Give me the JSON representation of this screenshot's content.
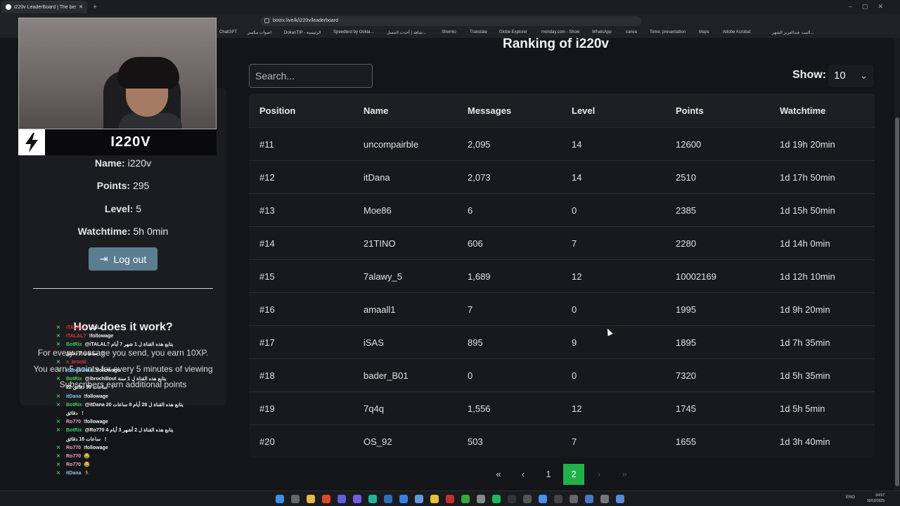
{
  "browser": {
    "tab_title": "i220v LeaderBoard | The best Ch",
    "url": "botrix.live/k/i220v/leaderboard",
    "bookmarks": [
      "ChatGPT",
      "اصوات مكسر",
      "DokanTIP - الرئيسية",
      "Speedtest by Ookla...",
      "شاهد | أحدث المسل...",
      "Stremio",
      "Translate",
      "Globe Explorer",
      "monday.com - Show",
      "WhatsApp",
      "canva",
      "Tome. presentation",
      "Maps",
      "Adobe Acrobat",
      "البيت عبدالعزيز الشهر..."
    ]
  },
  "page": {
    "ranking_title": "Ranking of i220v",
    "search_placeholder": "Search...",
    "show_label": "Show:",
    "show_value": "10"
  },
  "profile": {
    "banner_name": "I220V",
    "name_label": "Name:",
    "name_value": "i220v",
    "points_label": "Points:",
    "points_value": "295",
    "level_label": "Level:",
    "level_value": "5",
    "watchtime_label": "Watchtime:",
    "watchtime_value": "5h 0min",
    "logout_label": "Log out",
    "how_title": "How does it work?",
    "how_lines": [
      "For every message you send, you earn 10XP.",
      "You earn 5 points for every 5 minutes of viewing",
      "Subscribers earn additional points"
    ]
  },
  "chat": [
    {
      "user": "iTALAL?",
      "msg": "ماشي",
      "color": "#e0384a"
    },
    {
      "user": "iTALAL?",
      "msg": "!followage",
      "color": "#e0384a"
    },
    {
      "user": "BotRix",
      "msg": "@iTALAL? يتابع هذه القناة ل 1 شهر 7 أيام",
      "color": "#3ecf5a"
    },
    {
      "user": "",
      "msg": "ساعات 7 دقائق !",
      "color": "#3ecf5a"
    },
    {
      "user": "s_brocki",
      "msg": "",
      "color": "#e0384a"
    },
    {
      "user": "ibrochillout",
      "msg": "!followage",
      "color": "#7fc8f8"
    },
    {
      "user": "BotRix",
      "msg": "@ibrochillout يتابع هذه القناة ل 1 سنة",
      "color": "#3ecf5a"
    },
    {
      "user": "",
      "msg": "ساعات 39 دقائق 22 !",
      "color": "#3ecf5a"
    },
    {
      "user": "itDana",
      "msg": "!followage",
      "color": "#7fc8f8"
    },
    {
      "user": "BotRix",
      "msg": "@itDana يتابع هذه القناة ل 28 أيام 8 ساعات 20",
      "color": "#3ecf5a"
    },
    {
      "user": "",
      "msg": "دقائق !",
      "color": "#3ecf5a"
    },
    {
      "user": "Ro770",
      "msg": "!followage",
      "color": "#f5a0c0"
    },
    {
      "user": "BotRix",
      "msg": "@Ro770 يتابع هذه القناة ل 2 أشهر 3 أيام 4",
      "color": "#3ecf5a"
    },
    {
      "user": "",
      "msg": "ساعات 16 دقائق !",
      "color": "#3ecf5a"
    },
    {
      "user": "Ro770",
      "msg": "!followage",
      "color": "#f5a0c0"
    },
    {
      "user": "Ro770",
      "msg": "😂",
      "color": "#f5a0c0"
    },
    {
      "user": "Ro770",
      "msg": "😂",
      "color": "#f5a0c0"
    },
    {
      "user": "itDana",
      "msg": "🏃",
      "color": "#7fc8f8"
    }
  ],
  "table": {
    "headers": [
      "Position",
      "Name",
      "Messages",
      "Level",
      "Points",
      "Watchtime"
    ],
    "rows": [
      [
        "#11",
        "uncompairble",
        "2,095",
        "14",
        "12600",
        "1d 19h 20min"
      ],
      [
        "#12",
        "itDana",
        "2,073",
        "14",
        "2510",
        "1d 17h 50min"
      ],
      [
        "#13",
        "Moe86",
        "6",
        "0",
        "2385",
        "1d 15h 50min"
      ],
      [
        "#14",
        "21TINO",
        "606",
        "7",
        "2280",
        "1d 14h 0min"
      ],
      [
        "#15",
        "7alawy_5",
        "1,689",
        "12",
        "10002169",
        "1d 12h 10min"
      ],
      [
        "#16",
        "amaall1",
        "7",
        "0",
        "1995",
        "1d 9h 20min"
      ],
      [
        "#17",
        "iSAS",
        "895",
        "9",
        "1895",
        "1d 7h 35min"
      ],
      [
        "#18",
        "bader_B01",
        "0",
        "0",
        "7320",
        "1d 5h 35min"
      ],
      [
        "#19",
        "7q4q",
        "1,556",
        "12",
        "1745",
        "1d 5h 5min"
      ],
      [
        "#20",
        "OS_92",
        "503",
        "7",
        "1655",
        "1d 3h 40min"
      ]
    ]
  },
  "pagination": {
    "first": "«",
    "prev": "‹",
    "pages": [
      "1",
      "2"
    ],
    "active": "2",
    "next": "›",
    "last": "»"
  },
  "system": {
    "time": "04:57",
    "date": "30/12/2025",
    "lang": "ENG"
  },
  "colors": {
    "accent_green": "#22b04b",
    "logout_bg": "#5a7e90"
  }
}
